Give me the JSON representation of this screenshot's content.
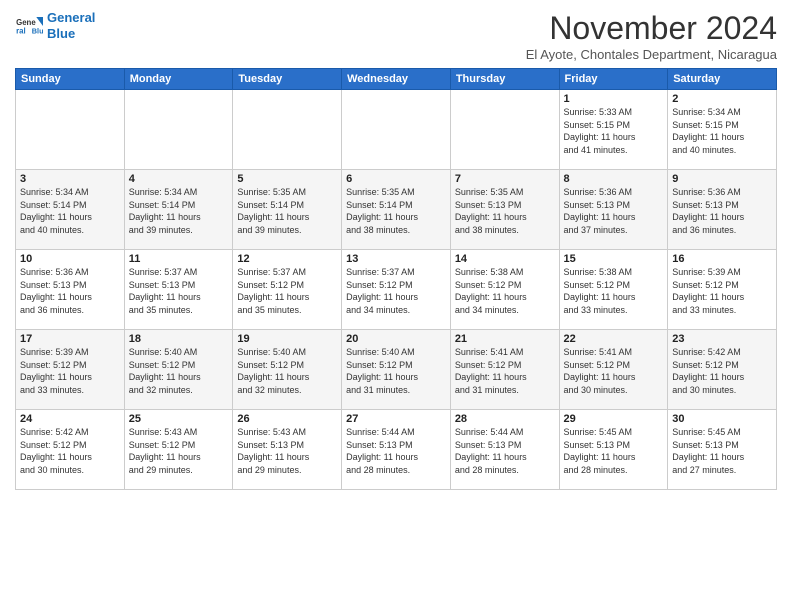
{
  "header": {
    "logo_line1": "General",
    "logo_line2": "Blue",
    "month": "November 2024",
    "location": "El Ayote, Chontales Department, Nicaragua"
  },
  "weekdays": [
    "Sunday",
    "Monday",
    "Tuesday",
    "Wednesday",
    "Thursday",
    "Friday",
    "Saturday"
  ],
  "weeks": [
    [
      {
        "day": "",
        "info": ""
      },
      {
        "day": "",
        "info": ""
      },
      {
        "day": "",
        "info": ""
      },
      {
        "day": "",
        "info": ""
      },
      {
        "day": "",
        "info": ""
      },
      {
        "day": "1",
        "info": "Sunrise: 5:33 AM\nSunset: 5:15 PM\nDaylight: 11 hours\nand 41 minutes."
      },
      {
        "day": "2",
        "info": "Sunrise: 5:34 AM\nSunset: 5:15 PM\nDaylight: 11 hours\nand 40 minutes."
      }
    ],
    [
      {
        "day": "3",
        "info": "Sunrise: 5:34 AM\nSunset: 5:14 PM\nDaylight: 11 hours\nand 40 minutes."
      },
      {
        "day": "4",
        "info": "Sunrise: 5:34 AM\nSunset: 5:14 PM\nDaylight: 11 hours\nand 39 minutes."
      },
      {
        "day": "5",
        "info": "Sunrise: 5:35 AM\nSunset: 5:14 PM\nDaylight: 11 hours\nand 39 minutes."
      },
      {
        "day": "6",
        "info": "Sunrise: 5:35 AM\nSunset: 5:14 PM\nDaylight: 11 hours\nand 38 minutes."
      },
      {
        "day": "7",
        "info": "Sunrise: 5:35 AM\nSunset: 5:13 PM\nDaylight: 11 hours\nand 38 minutes."
      },
      {
        "day": "8",
        "info": "Sunrise: 5:36 AM\nSunset: 5:13 PM\nDaylight: 11 hours\nand 37 minutes."
      },
      {
        "day": "9",
        "info": "Sunrise: 5:36 AM\nSunset: 5:13 PM\nDaylight: 11 hours\nand 36 minutes."
      }
    ],
    [
      {
        "day": "10",
        "info": "Sunrise: 5:36 AM\nSunset: 5:13 PM\nDaylight: 11 hours\nand 36 minutes."
      },
      {
        "day": "11",
        "info": "Sunrise: 5:37 AM\nSunset: 5:13 PM\nDaylight: 11 hours\nand 35 minutes."
      },
      {
        "day": "12",
        "info": "Sunrise: 5:37 AM\nSunset: 5:12 PM\nDaylight: 11 hours\nand 35 minutes."
      },
      {
        "day": "13",
        "info": "Sunrise: 5:37 AM\nSunset: 5:12 PM\nDaylight: 11 hours\nand 34 minutes."
      },
      {
        "day": "14",
        "info": "Sunrise: 5:38 AM\nSunset: 5:12 PM\nDaylight: 11 hours\nand 34 minutes."
      },
      {
        "day": "15",
        "info": "Sunrise: 5:38 AM\nSunset: 5:12 PM\nDaylight: 11 hours\nand 33 minutes."
      },
      {
        "day": "16",
        "info": "Sunrise: 5:39 AM\nSunset: 5:12 PM\nDaylight: 11 hours\nand 33 minutes."
      }
    ],
    [
      {
        "day": "17",
        "info": "Sunrise: 5:39 AM\nSunset: 5:12 PM\nDaylight: 11 hours\nand 33 minutes."
      },
      {
        "day": "18",
        "info": "Sunrise: 5:40 AM\nSunset: 5:12 PM\nDaylight: 11 hours\nand 32 minutes."
      },
      {
        "day": "19",
        "info": "Sunrise: 5:40 AM\nSunset: 5:12 PM\nDaylight: 11 hours\nand 32 minutes."
      },
      {
        "day": "20",
        "info": "Sunrise: 5:40 AM\nSunset: 5:12 PM\nDaylight: 11 hours\nand 31 minutes."
      },
      {
        "day": "21",
        "info": "Sunrise: 5:41 AM\nSunset: 5:12 PM\nDaylight: 11 hours\nand 31 minutes."
      },
      {
        "day": "22",
        "info": "Sunrise: 5:41 AM\nSunset: 5:12 PM\nDaylight: 11 hours\nand 30 minutes."
      },
      {
        "day": "23",
        "info": "Sunrise: 5:42 AM\nSunset: 5:12 PM\nDaylight: 11 hours\nand 30 minutes."
      }
    ],
    [
      {
        "day": "24",
        "info": "Sunrise: 5:42 AM\nSunset: 5:12 PM\nDaylight: 11 hours\nand 30 minutes."
      },
      {
        "day": "25",
        "info": "Sunrise: 5:43 AM\nSunset: 5:12 PM\nDaylight: 11 hours\nand 29 minutes."
      },
      {
        "day": "26",
        "info": "Sunrise: 5:43 AM\nSunset: 5:13 PM\nDaylight: 11 hours\nand 29 minutes."
      },
      {
        "day": "27",
        "info": "Sunrise: 5:44 AM\nSunset: 5:13 PM\nDaylight: 11 hours\nand 28 minutes."
      },
      {
        "day": "28",
        "info": "Sunrise: 5:44 AM\nSunset: 5:13 PM\nDaylight: 11 hours\nand 28 minutes."
      },
      {
        "day": "29",
        "info": "Sunrise: 5:45 AM\nSunset: 5:13 PM\nDaylight: 11 hours\nand 28 minutes."
      },
      {
        "day": "30",
        "info": "Sunrise: 5:45 AM\nSunset: 5:13 PM\nDaylight: 11 hours\nand 27 minutes."
      }
    ]
  ]
}
